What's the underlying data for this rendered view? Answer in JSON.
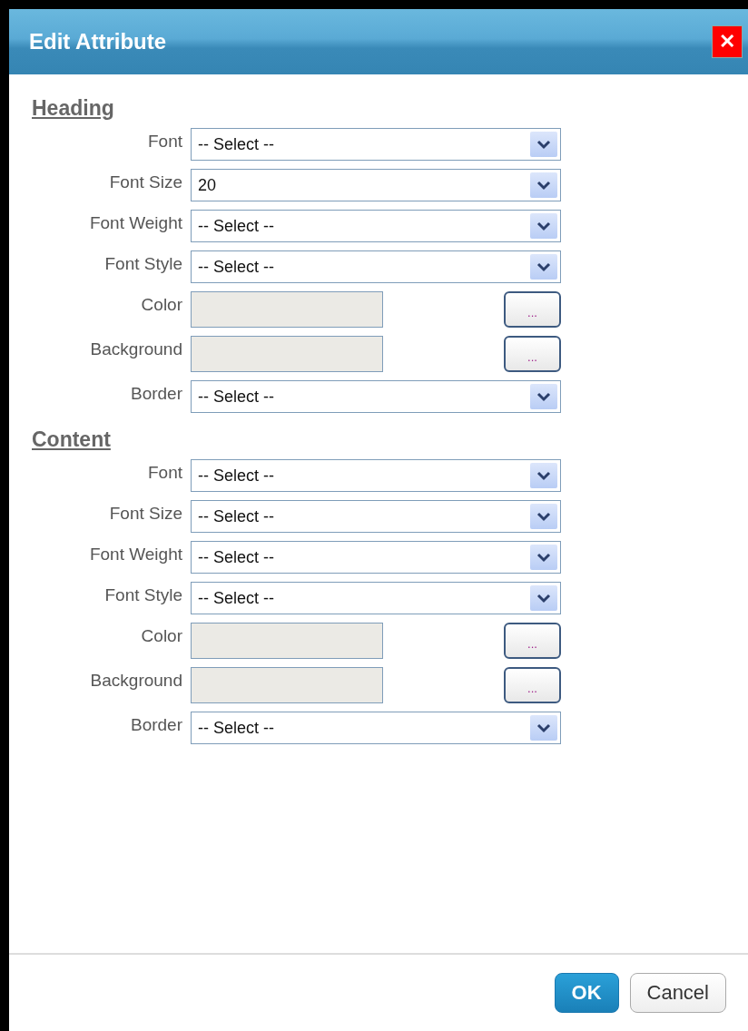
{
  "dialog": {
    "title": "Edit Attribute",
    "close": "✕"
  },
  "sections": [
    {
      "title": "Heading",
      "fields": [
        {
          "kind": "select",
          "label": "Font",
          "value": "-- Select --"
        },
        {
          "kind": "select",
          "label": "Font Size",
          "value": "20"
        },
        {
          "kind": "select",
          "label": "Font Weight",
          "value": "-- Select --"
        },
        {
          "kind": "select",
          "label": "Font Style",
          "value": "-- Select --"
        },
        {
          "kind": "color",
          "label": "Color",
          "button": "..."
        },
        {
          "kind": "color",
          "label": "Background",
          "button": "..."
        },
        {
          "kind": "select",
          "label": "Border",
          "value": "-- Select --"
        }
      ]
    },
    {
      "title": "Content",
      "fields": [
        {
          "kind": "select",
          "label": "Font",
          "value": "-- Select --"
        },
        {
          "kind": "select",
          "label": "Font Size",
          "value": "-- Select --"
        },
        {
          "kind": "select",
          "label": "Font Weight",
          "value": "-- Select --"
        },
        {
          "kind": "select",
          "label": "Font Style",
          "value": "-- Select --"
        },
        {
          "kind": "color",
          "label": "Color",
          "button": "..."
        },
        {
          "kind": "color",
          "label": "Background",
          "button": "..."
        },
        {
          "kind": "select",
          "label": "Border",
          "value": "-- Select --"
        }
      ]
    }
  ],
  "buttons": [
    {
      "kind": "primary",
      "label": "OK"
    },
    {
      "kind": "secondary",
      "label": "Cancel"
    }
  ]
}
